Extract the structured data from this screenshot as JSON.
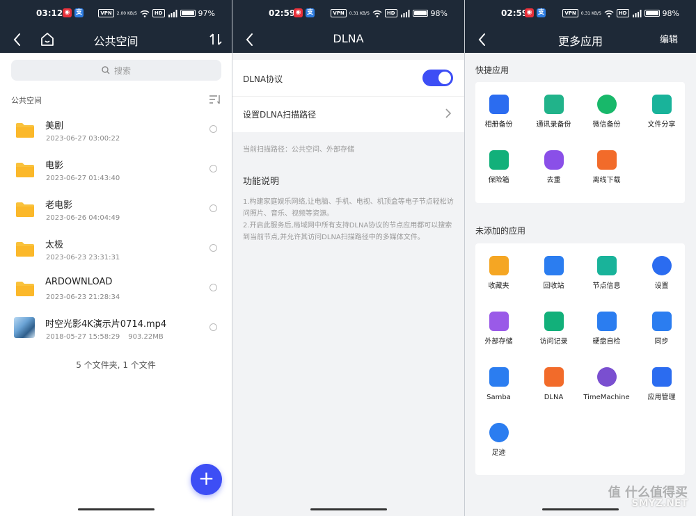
{
  "panel1": {
    "status": {
      "time": "03:12",
      "speed": "2.00 KB/S",
      "battery": "97%"
    },
    "title": "公共空间",
    "search_placeholder": "搜索",
    "section": "公共空间",
    "files": [
      {
        "name": "美剧",
        "date": "2023-06-27 03:00:22",
        "size": "",
        "type": "folder"
      },
      {
        "name": "电影",
        "date": "2023-06-27 01:43:40",
        "size": "",
        "type": "folder"
      },
      {
        "name": "老电影",
        "date": "2023-06-26 04:04:49",
        "size": "",
        "type": "folder"
      },
      {
        "name": "太极",
        "date": "2023-06-23 23:31:31",
        "size": "",
        "type": "folder"
      },
      {
        "name": "ARDOWNLOAD",
        "date": "2023-06-23 21:28:34",
        "size": "",
        "type": "folder"
      },
      {
        "name": "时空光影4K演示片0714.mp4",
        "date": "2018-05-27 15:58:29",
        "size": "903.22MB",
        "type": "video"
      }
    ],
    "summary": "5 个文件夹, 1 个文件",
    "fab": "+"
  },
  "panel2": {
    "status": {
      "time": "02:59",
      "speed": "0.31 KB/S",
      "battery": "98%"
    },
    "title": "DLNA",
    "protocol_label": "DLNA协议",
    "protocol_enabled": true,
    "scan_path_label": "设置DLNA扫描路径",
    "current_path": "当前扫描路径：公共空间、外部存储",
    "func_title": "功能说明",
    "func_desc": [
      "1.构建家庭娱乐网络,让电脑、手机、电视、机顶盒等电子节点轻松访问照片、音乐、视频等资源。",
      "2.开启此服务后,局域网中所有支持DLNA协议的节点应用都可以搜索到当前节点,并允许其访问DLNA扫描路径中的多媒体文件。"
    ]
  },
  "panel3": {
    "status": {
      "time": "02:59",
      "speed": "0.31 KB/S",
      "battery": "98%"
    },
    "title": "更多应用",
    "edit": "编辑",
    "quick_title": "快捷应用",
    "quick_apps": [
      {
        "label": "相册备份",
        "color": "#2b6cf0"
      },
      {
        "label": "通讯录备份",
        "color": "#21b38a"
      },
      {
        "label": "微信备份",
        "color": "#18b86a"
      },
      {
        "label": "文件分享",
        "color": "#19b39a"
      },
      {
        "label": "保险箱",
        "color": "#12b07a"
      },
      {
        "label": "去重",
        "color": "#8a4fe8"
      },
      {
        "label": "离线下载",
        "color": "#f26b2a"
      }
    ],
    "unadded_title": "未添加的应用",
    "unadded_apps": [
      {
        "label": "收藏夹",
        "color": "#f5a623"
      },
      {
        "label": "回收站",
        "color": "#2b7df0"
      },
      {
        "label": "节点信息",
        "color": "#19b39a"
      },
      {
        "label": "设置",
        "color": "#2b6cf0"
      },
      {
        "label": "外部存储",
        "color": "#9a5ae8"
      },
      {
        "label": "访问记录",
        "color": "#12b07a"
      },
      {
        "label": "硬盘自检",
        "color": "#2b7df0"
      },
      {
        "label": "同步",
        "color": "#2b7df0"
      },
      {
        "label": "Samba",
        "color": "#2b7df0"
      },
      {
        "label": "DLNA",
        "color": "#f26b2a"
      },
      {
        "label": "TimeMachine",
        "color": "#7a4fd0"
      },
      {
        "label": "应用管理",
        "color": "#2b6cf0"
      },
      {
        "label": "足迹",
        "color": "#2b7df0"
      }
    ]
  },
  "watermark": "值 什么值得买",
  "watermark2": "SMYZ.NET"
}
